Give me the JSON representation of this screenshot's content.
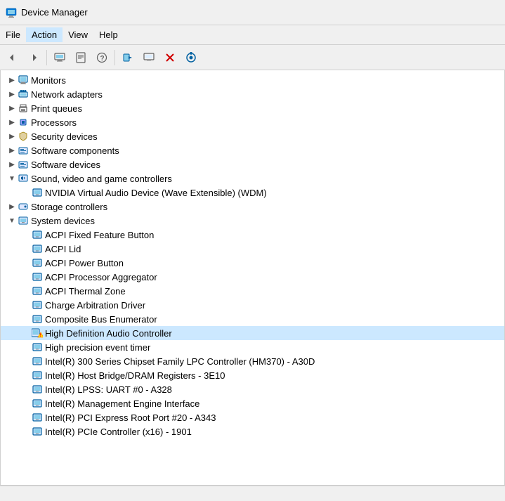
{
  "titleBar": {
    "title": "Device Manager",
    "iconColor": "#0078d7"
  },
  "menuBar": {
    "items": [
      "File",
      "Action",
      "View",
      "Help"
    ]
  },
  "toolbar": {
    "buttons": [
      {
        "name": "back",
        "label": "◀"
      },
      {
        "name": "forward",
        "label": "▶"
      },
      {
        "name": "device-manager",
        "label": "⊞"
      },
      {
        "name": "properties",
        "label": "☰"
      },
      {
        "name": "help",
        "label": "?"
      },
      {
        "name": "update-driver",
        "label": "⊡"
      },
      {
        "name": "display-toggle",
        "label": "🖥"
      },
      {
        "name": "uninstall",
        "label": "✖"
      },
      {
        "name": "scan-changes",
        "label": "⊕"
      }
    ]
  },
  "tree": {
    "items": [
      {
        "id": "monitors",
        "level": 1,
        "toggle": "▶",
        "label": "Monitors",
        "icon": "monitor"
      },
      {
        "id": "network-adapters",
        "level": 1,
        "toggle": "▶",
        "label": "Network adapters",
        "icon": "network"
      },
      {
        "id": "print-queues",
        "level": 1,
        "toggle": "▶",
        "label": "Print queues",
        "icon": "printer"
      },
      {
        "id": "processors",
        "level": 1,
        "toggle": "▶",
        "label": "Processors",
        "icon": "processor"
      },
      {
        "id": "security-devices",
        "level": 1,
        "toggle": "▶",
        "label": "Security devices",
        "icon": "security"
      },
      {
        "id": "software-components",
        "level": 1,
        "toggle": "▶",
        "label": "Software components",
        "icon": "software"
      },
      {
        "id": "software-devices",
        "level": 1,
        "toggle": "▶",
        "label": "Software devices",
        "icon": "software"
      },
      {
        "id": "sound-video",
        "level": 1,
        "toggle": "▼",
        "label": "Sound, video and game controllers",
        "icon": "sound"
      },
      {
        "id": "nvidia-audio",
        "level": 2,
        "toggle": " ",
        "label": "NVIDIA Virtual Audio Device (Wave Extensible) (WDM)",
        "icon": "device"
      },
      {
        "id": "storage-controllers",
        "level": 1,
        "toggle": "▶",
        "label": "Storage controllers",
        "icon": "storage"
      },
      {
        "id": "system-devices",
        "level": 1,
        "toggle": "▼",
        "label": "System devices",
        "icon": "system"
      },
      {
        "id": "acpi-fixed",
        "level": 2,
        "toggle": " ",
        "label": "ACPI Fixed Feature Button",
        "icon": "device"
      },
      {
        "id": "acpi-lid",
        "level": 2,
        "toggle": " ",
        "label": "ACPI Lid",
        "icon": "device"
      },
      {
        "id": "acpi-power",
        "level": 2,
        "toggle": " ",
        "label": "ACPI Power Button",
        "icon": "device"
      },
      {
        "id": "acpi-processor",
        "level": 2,
        "toggle": " ",
        "label": "ACPI Processor Aggregator",
        "icon": "device"
      },
      {
        "id": "acpi-thermal",
        "level": 2,
        "toggle": " ",
        "label": "ACPI Thermal Zone",
        "icon": "device"
      },
      {
        "id": "charge-arbitration",
        "level": 2,
        "toggle": " ",
        "label": "Charge Arbitration Driver",
        "icon": "device"
      },
      {
        "id": "composite-bus",
        "level": 2,
        "toggle": " ",
        "label": "Composite Bus Enumerator",
        "icon": "device"
      },
      {
        "id": "hd-audio",
        "level": 2,
        "toggle": " ",
        "label": "High Definition Audio Controller",
        "icon": "device-warning",
        "selected": true
      },
      {
        "id": "high-precision",
        "level": 2,
        "toggle": " ",
        "label": "High precision event timer",
        "icon": "device"
      },
      {
        "id": "intel-300-chipset",
        "level": 2,
        "toggle": " ",
        "label": "Intel(R) 300 Series Chipset Family LPC Controller (HM370) - A30D",
        "icon": "device"
      },
      {
        "id": "intel-host-bridge",
        "level": 2,
        "toggle": " ",
        "label": "Intel(R) Host Bridge/DRAM Registers - 3E10",
        "icon": "device"
      },
      {
        "id": "intel-lpss",
        "level": 2,
        "toggle": " ",
        "label": "Intel(R) LPSS: UART #0 - A328",
        "icon": "device"
      },
      {
        "id": "intel-management",
        "level": 2,
        "toggle": " ",
        "label": "Intel(R) Management Engine Interface",
        "icon": "device"
      },
      {
        "id": "intel-pci-express",
        "level": 2,
        "toggle": " ",
        "label": "Intel(R) PCI Express Root Port #20 - A343",
        "icon": "device"
      },
      {
        "id": "intel-pcie-controller",
        "level": 2,
        "toggle": " ",
        "label": "Intel(R) PCIe Controller (x16) - 1901",
        "icon": "device"
      }
    ]
  },
  "statusBar": {
    "text": ""
  }
}
